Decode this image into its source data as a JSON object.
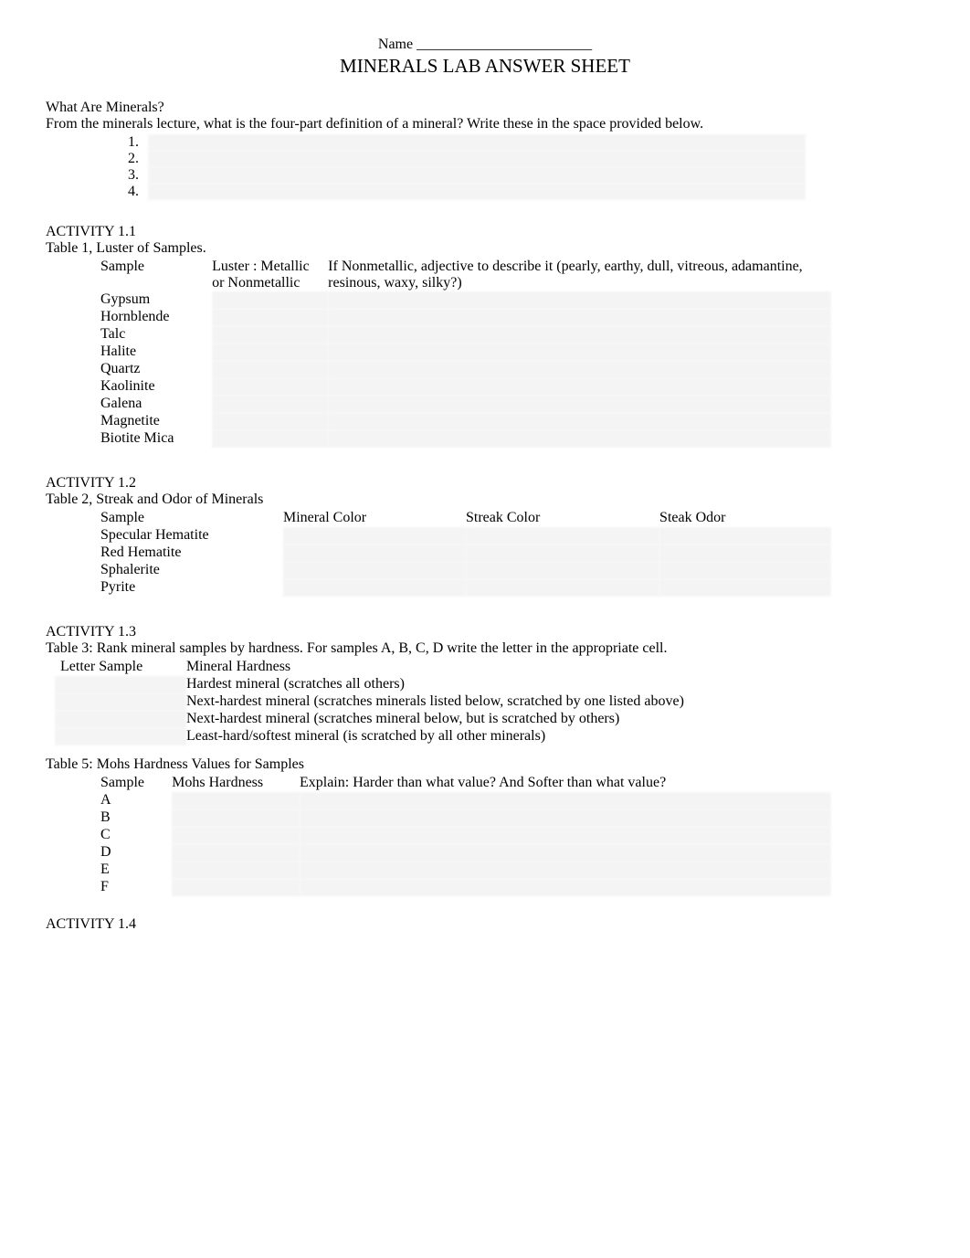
{
  "header": {
    "name_label": "Name ________________________",
    "title": "MINERALS LAB ANSWER SHEET"
  },
  "intro": {
    "heading": "What Are Minerals?",
    "prompt": "From the minerals lecture, what is the four-part definition of a mineral? Write these in the space provided below.",
    "items": [
      "1.",
      "2.",
      "3.",
      "4."
    ]
  },
  "activity11": {
    "title": "ACTIVITY 1.1",
    "table_caption": "Table 1, Luster of Samples.",
    "headers": {
      "sample": "Sample",
      "luster": "Luster : Metallic or Nonmetallic",
      "adjective": "If Nonmetallic, adjective to describe it (pearly, earthy, dull, vitreous, adamantine, resinous, waxy, silky?)"
    },
    "rows": [
      "Gypsum",
      "Hornblende",
      "Talc",
      "Halite",
      "Quartz",
      "Kaolinite",
      "Galena",
      "Magnetite",
      "Biotite Mica"
    ]
  },
  "activity12": {
    "title": "ACTIVITY 1.2",
    "table_caption": "Table 2, Streak and Odor of Minerals",
    "headers": {
      "sample": "Sample",
      "color": "Mineral Color",
      "streak": "Streak Color",
      "odor": "Steak Odor"
    },
    "rows": [
      "Specular Hematite",
      "Red Hematite",
      "Sphalerite",
      "Pyrite"
    ]
  },
  "activity13": {
    "title": "ACTIVITY 1.3",
    "table3_caption": "Table 3:   Rank mineral samples by hardness. For samples A, B, C, D write the letter in the appropriate cell.",
    "table3_headers": {
      "letter": "Letter Sample",
      "hardness": "Mineral Hardness"
    },
    "table3_rows": [
      "Hardest mineral (scratches all others)",
      "Next-hardest mineral (scratches minerals listed below, scratched by one listed above)",
      "Next-hardest mineral (scratches mineral below, but is scratched by others)",
      "Least-hard/softest mineral (is scratched by all other minerals)"
    ],
    "table5_caption": "Table 5: Mohs Hardness Values for Samples",
    "table5_headers": {
      "sample": "Sample",
      "mohs": "Mohs Hardness",
      "explain": "Explain: Harder than what value? And Softer than what value?"
    },
    "table5_rows": [
      "A",
      "B",
      "C",
      "D",
      "E",
      "F"
    ]
  },
  "activity14": {
    "title": "ACTIVITY 1.4"
  }
}
